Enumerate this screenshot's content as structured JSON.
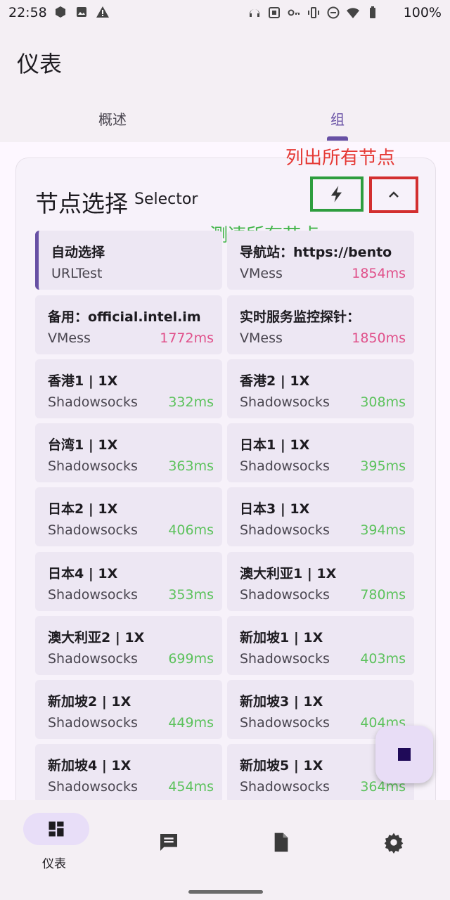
{
  "status_bar": {
    "time": "22:58",
    "battery": "100%"
  },
  "header": {
    "title": "仪表",
    "tabs": [
      "概述",
      "组"
    ]
  },
  "group_card": {
    "title": "节点选择",
    "subtitle": "Selector",
    "annotation_list_all": "列出所有节点",
    "annotation_test_all": "测速所有节点"
  },
  "proxies": [
    {
      "name": "自动选择",
      "type": "URLTest",
      "delay": ""
    },
    {
      "name": "导航站：https://bento",
      "type": "VMess",
      "delay": "1854ms"
    },
    {
      "name": "备用：official.intel.im",
      "type": "VMess",
      "delay": "1772ms"
    },
    {
      "name": "实时服务监控探针：",
      "type": "VMess",
      "delay": "1850ms"
    },
    {
      "name": "香港1 | 1X",
      "type": "Shadowsocks",
      "delay": "332ms"
    },
    {
      "name": "香港2 | 1X",
      "type": "Shadowsocks",
      "delay": "308ms"
    },
    {
      "name": "台湾1 | 1X",
      "type": "Shadowsocks",
      "delay": "363ms"
    },
    {
      "name": "日本1 | 1X",
      "type": "Shadowsocks",
      "delay": "395ms"
    },
    {
      "name": "日本2 | 1X",
      "type": "Shadowsocks",
      "delay": "406ms"
    },
    {
      "name": "日本3 | 1X",
      "type": "Shadowsocks",
      "delay": "394ms"
    },
    {
      "name": "日本4 | 1X",
      "type": "Shadowsocks",
      "delay": "353ms"
    },
    {
      "name": "澳大利亚1 | 1X",
      "type": "Shadowsocks",
      "delay": "780ms"
    },
    {
      "name": "澳大利亚2 | 1X",
      "type": "Shadowsocks",
      "delay": "699ms"
    },
    {
      "name": "新加坡1 | 1X",
      "type": "Shadowsocks",
      "delay": "403ms"
    },
    {
      "name": "新加坡2 | 1X",
      "type": "Shadowsocks",
      "delay": "449ms"
    },
    {
      "name": "新加坡3 | 1X",
      "type": "Shadowsocks",
      "delay": "404ms"
    },
    {
      "name": "新加坡4 | 1X",
      "type": "Shadowsocks",
      "delay": "454ms"
    },
    {
      "name": "新加坡5 | 1X",
      "type": "Shadowsocks",
      "delay": "364ms"
    }
  ],
  "bottom_nav": {
    "active_label": "仪表"
  },
  "colors": {
    "accent": "#6750a4",
    "fast_delay": "#5cc25c",
    "slow_delay": "#e0508a"
  }
}
